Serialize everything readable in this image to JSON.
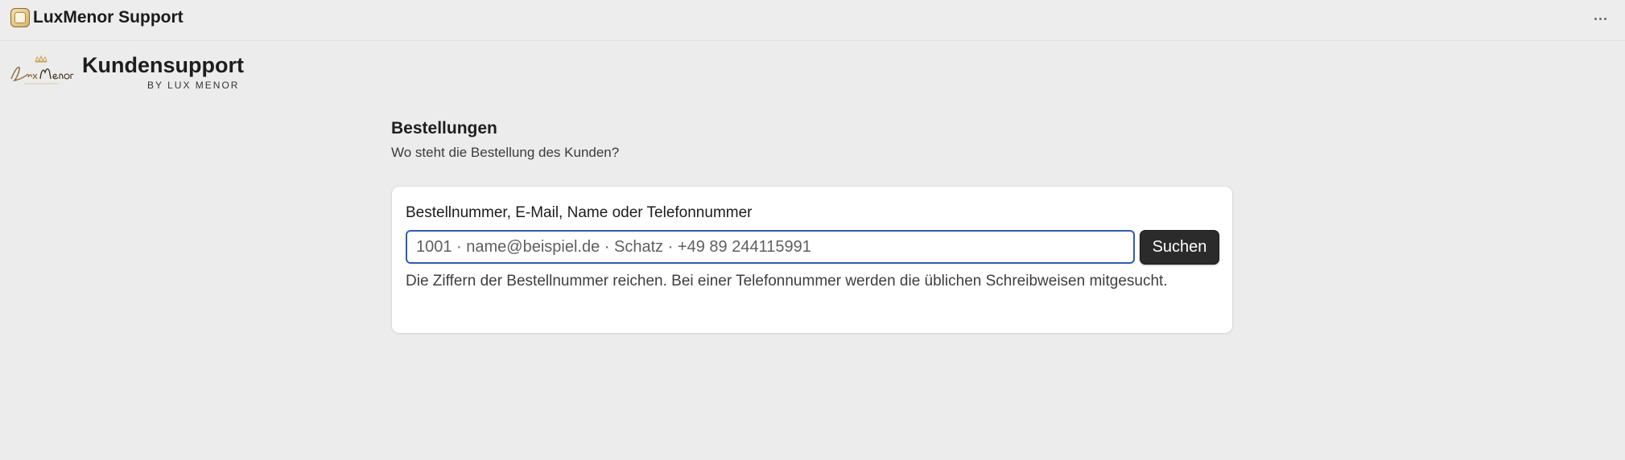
{
  "window": {
    "title": "LuxMenor Support",
    "menu_icon": "more-horizontal-icon",
    "app_icon": "luxmenor-app-icon"
  },
  "brand": {
    "logo_text": "LuxMenor",
    "title": "Kundensupport",
    "subtitle": "BY LUX MENOR"
  },
  "section": {
    "title": "Bestellungen",
    "subtitle": "Wo steht die Bestellung des Kunden?"
  },
  "search": {
    "label": "Bestellnummer, E-Mail, Name oder Telefonnummer",
    "value": "",
    "placeholder": "1001 · name@beispiel.de · Schatz · +49 89 244115991",
    "button_label": "Suchen",
    "help": "Die Ziffern der Bestellnummer reichen. Bei einer Telefonnummer werden die üblichen Schreibweisen mitgesucht."
  },
  "colors": {
    "background": "#ececec",
    "card": "#ffffff",
    "input_focus_border": "#2e5bbd",
    "button_bg": "#2b2b2b",
    "brand_gold": "#c9a24a"
  }
}
